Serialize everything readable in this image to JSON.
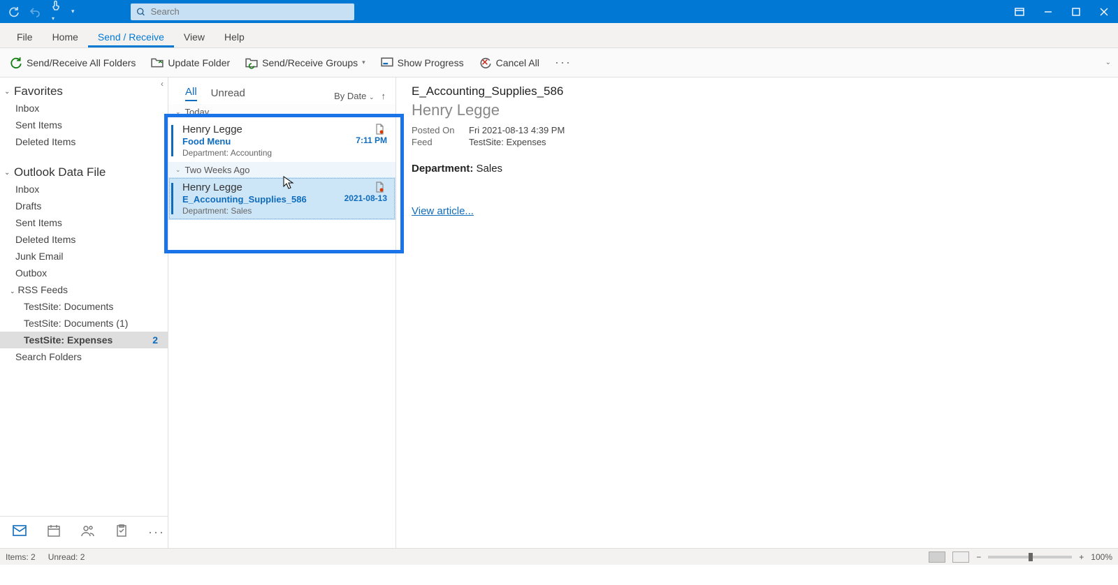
{
  "search": {
    "placeholder": "Search"
  },
  "menu": {
    "file": "File",
    "home": "Home",
    "sendreceive": "Send / Receive",
    "view": "View",
    "help": "Help"
  },
  "ribbon": {
    "sendreceive_all": "Send/Receive All Folders",
    "update_folder": "Update Folder",
    "groups": "Send/Receive Groups",
    "show_progress": "Show Progress",
    "cancel_all": "Cancel All"
  },
  "nav": {
    "favorites": "Favorites",
    "fav_items": {
      "inbox": "Inbox",
      "sent": "Sent Items",
      "deleted": "Deleted Items"
    },
    "datafile": "Outlook Data File",
    "df_items": {
      "inbox": "Inbox",
      "drafts": "Drafts",
      "sent": "Sent Items",
      "deleted": "Deleted Items",
      "junk": "Junk Email",
      "outbox": "Outbox",
      "rss": "RSS Feeds",
      "rss1": "TestSite: Documents",
      "rss2": "TestSite: Documents (1)",
      "rss3": "TestSite: Expenses",
      "rss3_count": "2",
      "search": "Search Folders"
    }
  },
  "list": {
    "tab_all": "All",
    "tab_unread": "Unread",
    "sort": "By Date",
    "g_today": "Today",
    "g_two_weeks": "Two Weeks Ago",
    "m1": {
      "from": "Henry Legge",
      "subject": "Food Menu",
      "date": "7:11 PM",
      "preview": "Department: Accounting"
    },
    "m2": {
      "from": "Henry Legge",
      "subject": "E_Accounting_Supplies_586",
      "date": "2021-08-13",
      "preview": "Department: Sales"
    }
  },
  "reading": {
    "subject": "E_Accounting_Supplies_586",
    "sender": "Henry Legge",
    "posted_label": "Posted On",
    "posted_value": "Fri 2021-08-13 4:39 PM",
    "feed_label": "Feed",
    "feed_value": "TestSite: Expenses",
    "body_label": "Department:",
    "body_value": "Sales",
    "link": "View article..."
  },
  "status": {
    "items": "Items: 2",
    "unread": "Unread: 2",
    "zoom": "100%"
  }
}
